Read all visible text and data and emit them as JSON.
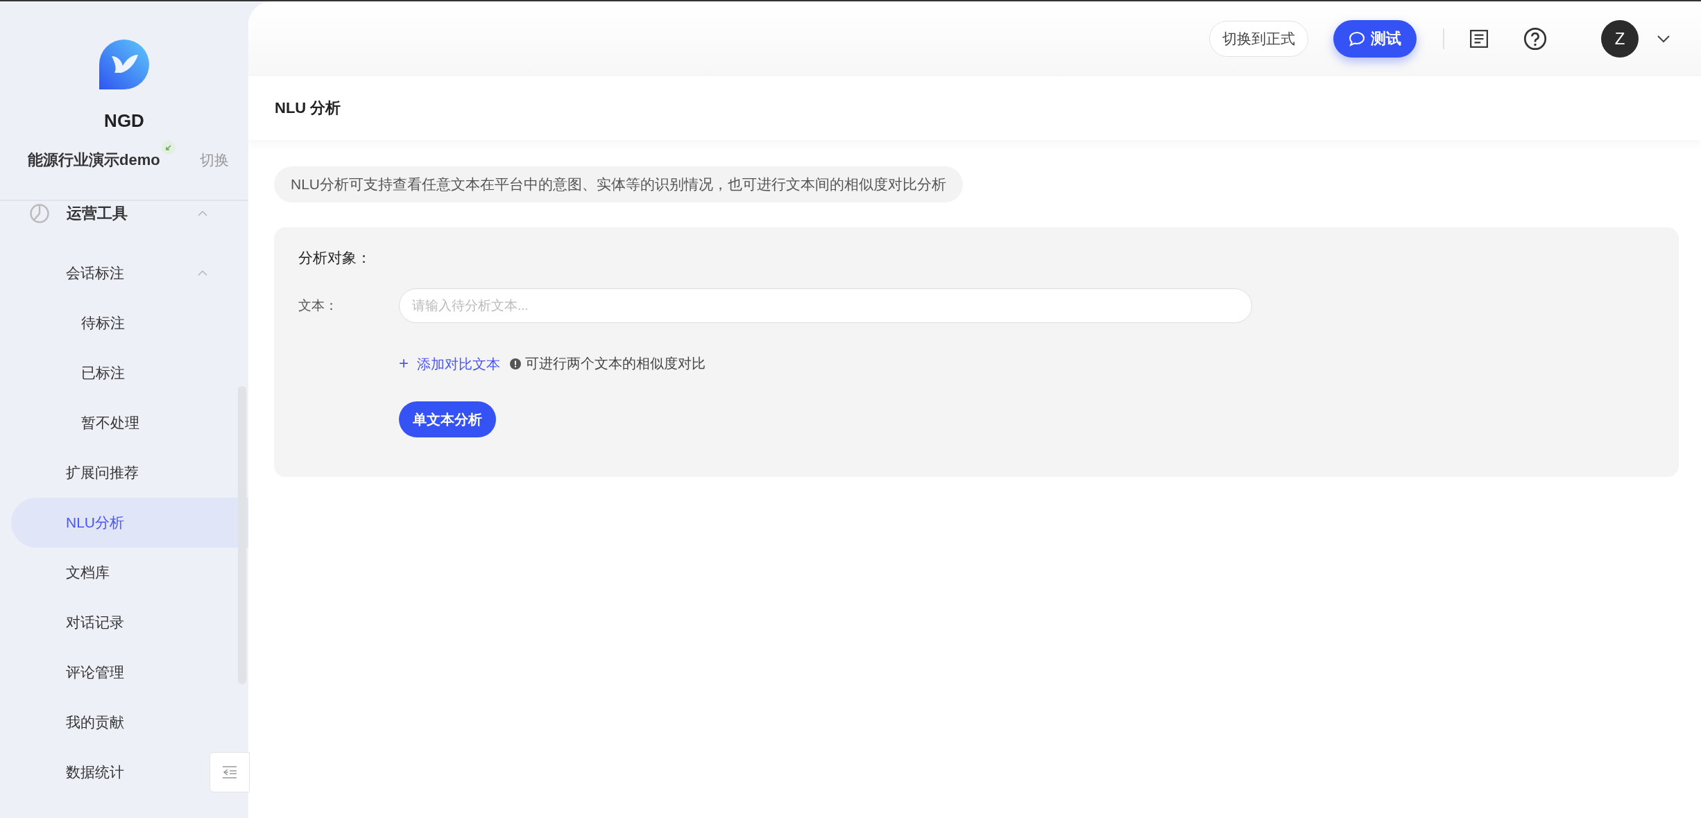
{
  "sidebar": {
    "app_name": "NGD",
    "project": {
      "name": "能源行业演示demo",
      "switch_label": "切换"
    },
    "menu": [
      {
        "label": "运营工具",
        "expanded": true,
        "selected": false,
        "children": [
          {
            "label": "会话标注",
            "expanded": true,
            "selected": false,
            "children": [
              {
                "label": "待标注",
                "selected": false
              },
              {
                "label": "已标注",
                "selected": false
              },
              {
                "label": "暂不处理",
                "selected": false
              }
            ]
          },
          {
            "label": "扩展问推荐",
            "selected": false
          },
          {
            "label": "NLU分析",
            "selected": true
          },
          {
            "label": "文档库",
            "selected": false
          },
          {
            "label": "对话记录",
            "selected": false
          },
          {
            "label": "评论管理",
            "selected": false
          },
          {
            "label": "我的贡献",
            "selected": false
          },
          {
            "label": "数据统计",
            "selected": false
          }
        ]
      }
    ]
  },
  "header": {
    "env_button": "切换到正式",
    "test_button": "测试",
    "avatar": "Z"
  },
  "page": {
    "title": "NLU 分析",
    "notice": "NLU分析可支持查看任意文本在平台中的意图、实体等的识别情况，也可进行文本间的相似度对比分析",
    "form": {
      "section_title": "分析对象：",
      "text_label": "文本：",
      "text_placeholder": "请输入待分析文本...",
      "add_compare": "添加对比文本",
      "add_compare_icon": "+",
      "hint": "可进行两个文本的相似度对比",
      "submit": "单文本分析"
    }
  }
}
